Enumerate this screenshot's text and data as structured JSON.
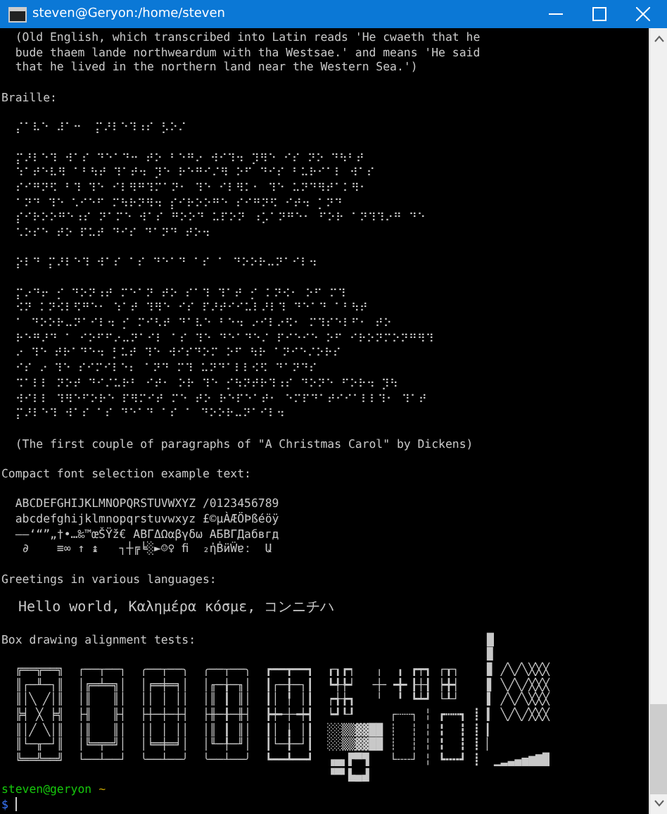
{
  "window": {
    "title": "steven@Geryon:/home/steven"
  },
  "terminal": {
    "blocks": [
      [
        "  (Old English, which transcribed into Latin reads 'He cwaeth that he",
        "  bude thaem lande northweardum with tha Westsae.' and means 'He said",
        "  that he lived in the northern land near the Western Sea.')"
      ],
      [
        "Braille:"
      ],
      [
        "  ⡌⠁⠧⠑ ⠼⠁⠒  ⡍⠜⠇⠑⠹⠰⠎ ⡣⠕⠌"
      ],
      [
        "  ⡍⠜⠇⠑⠹ ⠺⠁⠎ ⠙⠑⠁⠙⠒ ⠞⠕ ⠃⠑⠛⠔ ⠺⠊⠹⠲ ⡹⠻⠑ ⠊⠎ ⠝⠕ ⠙⠳⠃⠞",
        "  ⠱⠁⠞⠑⠧⠻ ⠁⠃⠳⠞ ⠹⠁⠞⠲ ⡹⠑ ⠗⠑⠛⠊⠌⠻ ⠕⠋ ⠙⠊⠎ ⠃⠥⠗⠊⠁⠇ ⠺⠁⠎",
        "  ⠎⠊⠛⠝⠫ ⠃⠹ ⠹⠑ ⠊⠇⠻⠛⠹⠍⠁⠝⠂ ⠹⠑ ⠊⠇⠻⠅⠂ ⠹⠑ ⠥⠝⠙⠻⠞⠁⠅⠻⠂",
        "  ⠁⠝⠙ ⠹⠑ ⠡⠊⠑⠋ ⠍⠳⠗⠝⠻⠲ ⡎⠊⠗⠕⠕⠛⠑ ⠎⠊⠛⠝⠫ ⠊⠞⠲ ⡁⠝⠙",
        "  ⡎⠊⠗⠕⠕⠛⠑⠰⠎ ⠝⠁⠍⠑ ⠺⠁⠎ ⠛⠕⠕⠙ ⠥⠏⠕⠝ ⠰⡡⠁⠝⠛⠑⠂ ⠋⠕⠗ ⠁⠝⠹⠹⠔⠛ ⠙⠑",
        "  ⠡⠕⠎⠑ ⠞⠕ ⠏⠥⠞ ⠙⠊⠎ ⠙⠁⠝⠙ ⠞⠕⠲"
      ],
      [
        "  ⡕⠇⠙ ⡍⠜⠇⠑⠹ ⠺⠁⠎ ⠁⠎ ⠙⠑⠁⠙ ⠁⠎ ⠁ ⠙⠕⠕⠗⠤⠝⠁⠊⠇⠲"
      ],
      [
        "  ⡍⠔⠙⠖ ⡊ ⠙⠕⠝⠰⠞ ⠍⠑⠁⠝ ⠞⠕ ⠎⠁⠹ ⠹⠁⠞ ⡊ ⠅⠝⠪⠂ ⠕⠋ ⠍⠹",
        "  ⠪⠝ ⠅⠝⠪⠇⠫⠛⠑⠂ ⠱⠁⠞ ⠹⠻⠑ ⠊⠎ ⠏⠜⠞⠊⠊⠥⠇⠜⠇⠹ ⠙⠑⠁⠙ ⠁⠃⠳⠞",
        "  ⠁ ⠙⠕⠕⠗⠤⠝⠁⠊⠇⠲ ⡊ ⠍⠊⠣⠞ ⠙⠁⠧⠑ ⠃⠑⠲ ⠔⠊⠇⠔⠫⠂ ⠍⠹⠎⠑⠇⠋⠂ ⠞⠕",
        "  ⠗⠑⠛⠜⠙ ⠁ ⠊⠕⠋⠋⠔⠤⠝⠁⠊⠇ ⠁⠎ ⠹⠑ ⠙⠑⠁⠙⠑⠌ ⠏⠊⠑⠊⠑ ⠕⠋ ⠊⠗⠕⠝⠍⠕⠝⠛⠻⠹",
        "  ⠔ ⠹⠑ ⠞⠗⠁⠙⠑⠲ ⡃⠥⠞ ⠹⠑ ⠺⠊⠎⠙⠕⠍ ⠕⠋ ⠳⠗ ⠁⠝⠊⠑⠌⠕⠗⠎",
        "  ⠊⠎ ⠔ ⠹⠑ ⠎⠊⠍⠊⠇⠑⠆ ⠁⠝⠙ ⠍⠹ ⠥⠝⠙⠁⠇⠇⠪⠫ ⠙⠁⠝⠙⠎",
        "  ⠩⠁⠇⠇ ⠝⠕⠞ ⠙⠊⠌⠥⠗⠃ ⠊⠞⠂ ⠕⠗ ⠹⠑ ⡊⠳⠝⠞⠗⠹⠰⠎ ⠙⠕⠝⠑ ⠋⠕⠗⠲ ⡹⠳",
        "  ⠺⠊⠇⠇ ⠹⠻⠑⠋⠕⠗⠑ ⠏⠻⠍⠊⠞ ⠍⠑ ⠞⠕ ⠗⠑⠏⠑⠁⠞⠂ ⠑⠍⠏⠙⠁⠞⠊⠊⠁⠇⠇⠹⠂ ⠹⠁⠞",
        "  ⡍⠜⠇⠑⠹ ⠺⠁⠎ ⠁⠎ ⠙⠑⠁⠙ ⠁⠎ ⠁ ⠙⠕⠕⠗⠤⠝⠁⠊⠇⠲"
      ],
      [
        "  (The first couple of paragraphs of \"A Christmas Carol\" by Dickens)"
      ],
      [
        "Compact font selection example text:"
      ],
      [
        "  ABCDEFGHIJKLMNOPQRSTUVWXYZ /0123456789",
        "  abcdefghijklmnopqrstuvwxyz £©µÀÆÖÞßéöÿ",
        "  –—‘“”„†•…‰™œŠŸž€ ΑΒΓΔΩαβγδω АБВГДабвгд",
        "   ∂    ≡∞ ↑ ↨   ┐┼╔╘░►☺♀ ﬁ  ₂ἠḂӥẄɐː  Ա"
      ],
      [
        "Greetings in various languages:"
      ],
      [
        "  Hello world, Καλημέρα κόσμε, コンニチハ"
      ],
      [
        "Box drawing alignment tests:                                          █",
        "                                                                      ▉",
        "  ╔══╦══╗  ┌──┬──┐  ╭──┬──╮  ╭──┬──╮  ┏━━┳━━┓  ┎┒┏┑   ╷  ╻ ┏┯┓ ┌┰┐    ▊ ╱╲╱╲╳╳╳",
        "  ║┌─╨─┐║  │╔═╧═╗│  │╒═╪═╕│  │╓─╁─╖│  ┃┌─╂─┐┃  ┗╃╄┙  ╶┼╴╺╋╸┠┼┨ ┝╋┥    ▋ ╲╱╲╱╳╳╳",
        "  ║│╲ ╱│║  │║   ║│  ││ │ ││  │║ ┃ ║│  ┃│ ╿ │┃  ┍╅╆┓   ╵  ╹ ┗┷┛ └┸┘    ▌ ╱╲╱╲╳╳╳",
        "  ╠╡ ╳ ╞╣  ├╢   ╟┤  ├┼─┼─┼┤  ├╫─╂─╫┤  ┣┿╾┼╼┿┫  ┕┛┖┚     ┌┄┄┐ ╎ ┏┅┅┓ ┋ ▍ ╲╱╲╱╳╳╳",
        "  ║│╱ ╲│║  │║   ║│  ││ │ ││  │║ ┃ ║│  ┃│ ╽ │┃  ░░▒▒▓▓██ ┊  ┆ ╎ ╏  ┇ ┋ ▎",
        "  ║└─╥─┘║  │╚═╤═╝│  │╘═╪═╛│  │╙─╀─╜│  ┃└─╂─┘┃  ░░▒▒▓▓██ ┊  ┆ ╎ ╏  ┇ ┋ ▏",
        "  ╚══╩══╝  └──┴──┘  ╰──┴──╯  ╰──┴──╯  ┗━━┻━━┛  ▗▄▖▛▀▜   └╌╌┘ ╎ ┗╍╍┛ ┋  ▁▂▃▄▅▆▇█",
        "                                               ▝▀▘▙▄▟"
      ]
    ],
    "prompt": {
      "user_host": "steven@geryon",
      "path": "~",
      "symbol": "$"
    }
  }
}
